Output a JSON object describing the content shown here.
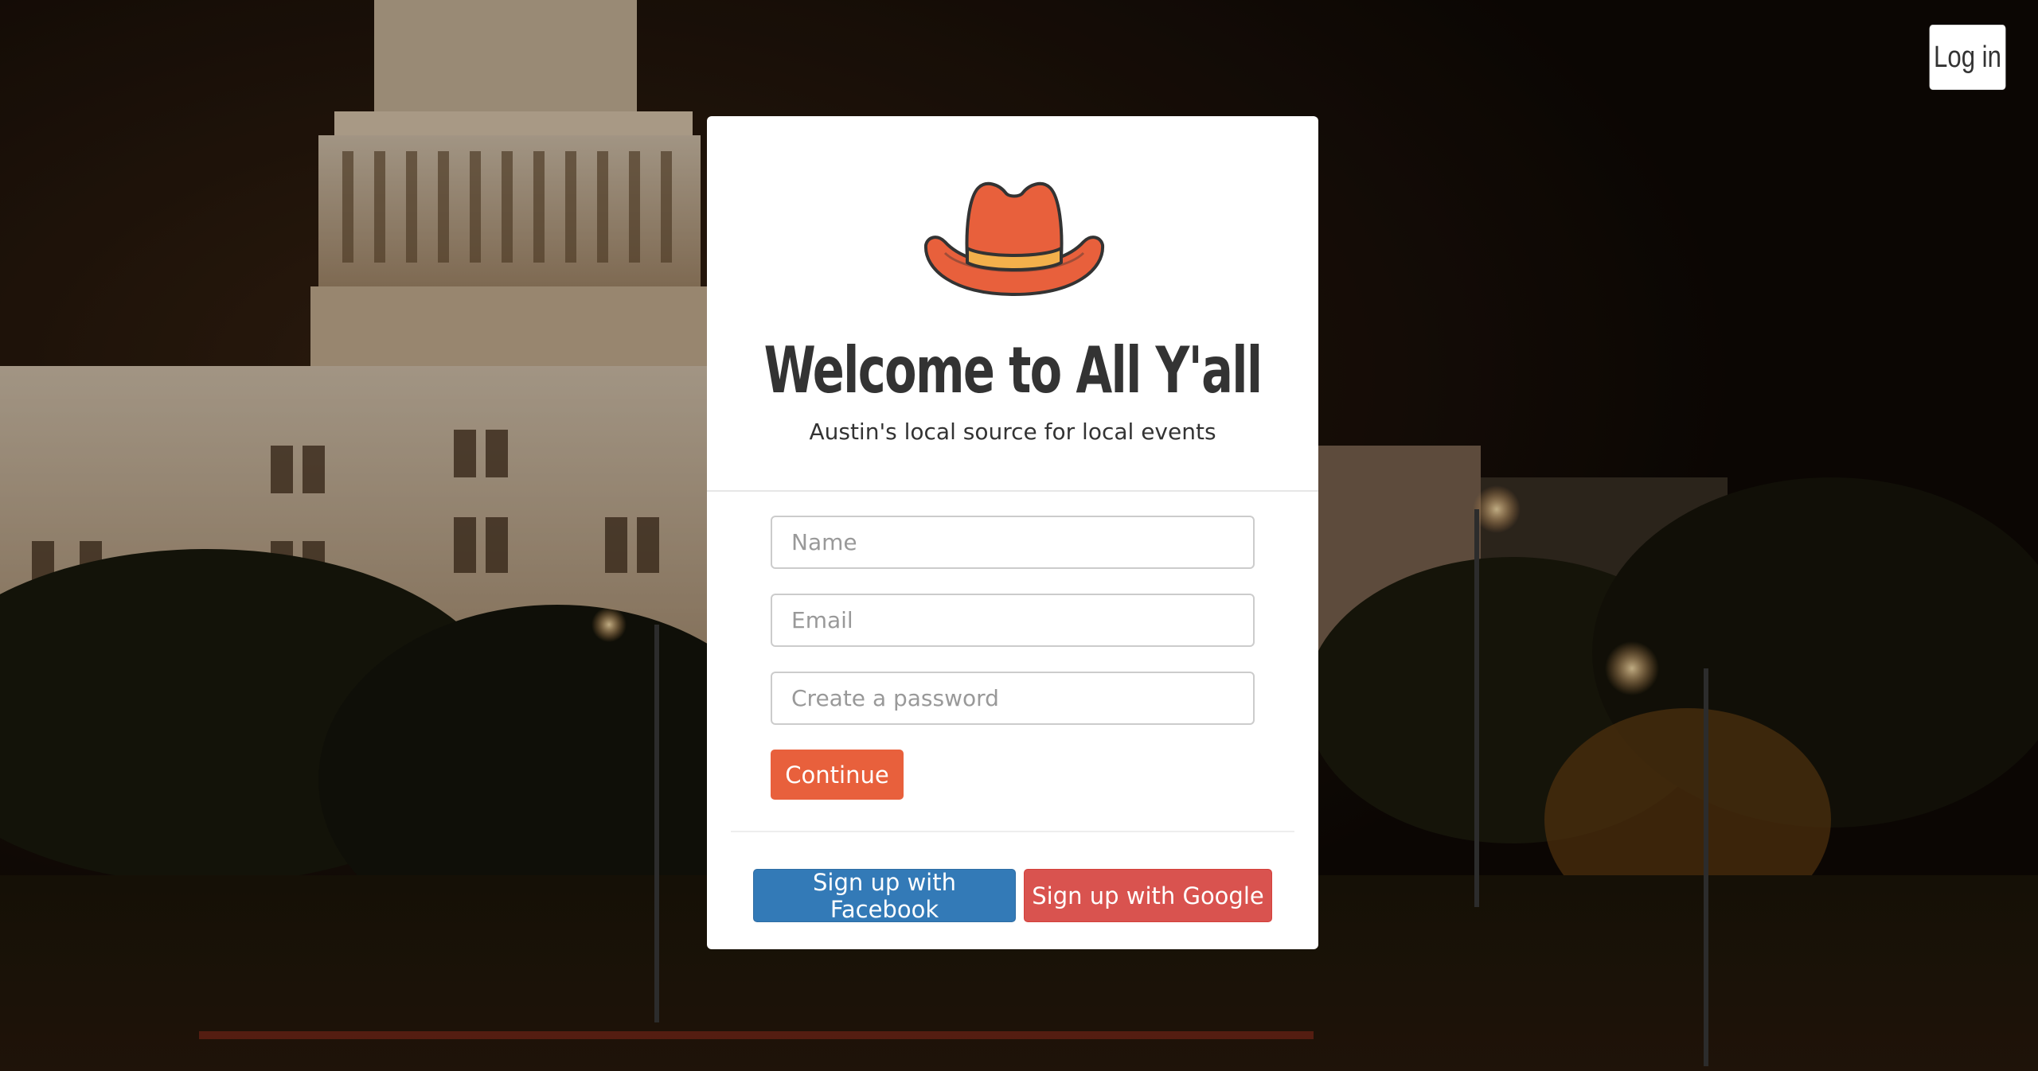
{
  "header": {
    "login_label": "Log in"
  },
  "card": {
    "logo_icon": "cowboy-hat-icon",
    "title": "Welcome to All Y'all",
    "subtitle": "Austin's local source for local events",
    "form": {
      "name_placeholder": "Name",
      "email_placeholder": "Email",
      "password_placeholder": "Create a password",
      "continue_label": "Continue"
    },
    "social": {
      "facebook_label": "Sign up with Facebook",
      "google_label": "Sign up with Google"
    }
  },
  "colors": {
    "accent": "#e8603c",
    "facebook": "#337ab7",
    "google": "#d9534f",
    "hat_band": "#f3b04b"
  },
  "background": {
    "scene": "texas-capitol-at-night"
  }
}
